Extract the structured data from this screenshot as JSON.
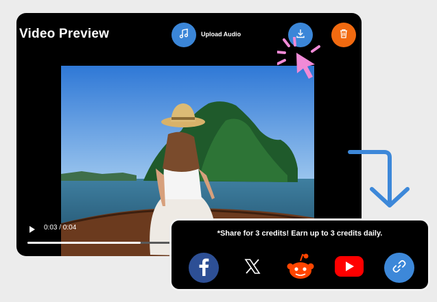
{
  "header": {
    "title": "Video Preview",
    "upload_audio_label": "Upload Audio",
    "icons": {
      "upload_audio": "music-note-icon",
      "download": "download-icon",
      "delete": "trash-icon"
    }
  },
  "player": {
    "time": "0:03 / 0:04",
    "progress_fraction": 0.75,
    "play_icon": "play-icon"
  },
  "share": {
    "message": "*Share for 3 credits! Earn up to 3 credits daily.",
    "platforms": [
      "facebook-icon",
      "x-icon",
      "reddit-icon",
      "youtube-icon",
      "link-icon"
    ]
  },
  "colors": {
    "accent_blue": "#3b86d8",
    "delete_orange": "#f26a10",
    "cursor_pink": "#f08ad6",
    "facebook": "#2d4f95",
    "youtube": "#ff0000",
    "reddit": "#ff4500"
  }
}
